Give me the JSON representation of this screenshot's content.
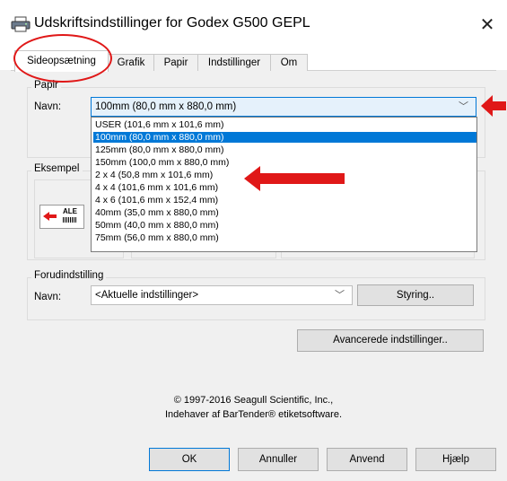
{
  "window": {
    "title": "Udskriftsindstillinger for Godex G500 GEPL",
    "close_label": "✕"
  },
  "tabs": [
    "Sideopsætning",
    "Grafik",
    "Papir",
    "Indstillinger",
    "Om"
  ],
  "active_tab": "Sideopsætning",
  "paper_group": {
    "label": "Papir",
    "name_label": "Navn:",
    "selected": "100mm (80,0 mm x 880,0 mm)",
    "options": [
      "USER (101,6 mm x 101,6 mm)",
      "100mm (80,0 mm x 880,0 mm)",
      "125mm (80,0 mm x 880,0 mm)",
      "150mm (100,0 mm x 880,0 mm)",
      "2 x 4 (50,8 mm x 101,6 mm)",
      "4 x 4 (101,6 mm x 101,6 mm)",
      "4 x 6 (101,6 mm x 152,4 mm)",
      "40mm (35,0 mm x 880,0 mm)",
      "50mm (40,0 mm x 880,0 mm)",
      "75mm (56,0 mm x 880,0 mm)"
    ],
    "highlighted_index": 1
  },
  "example_group": {
    "label": "Eksempel",
    "preview_text": "ALE"
  },
  "preset_group": {
    "label": "Forudindstilling",
    "name_label": "Navn:",
    "selected": "<Aktuelle indstillinger>",
    "manage_button": "Styring.."
  },
  "advanced_button": "Avancerede indstillinger..",
  "copyright": {
    "line1": "© 1997-2016 Seagull Scientific, Inc.,",
    "line2": "Indehaver af BarTender® etiketsoftware."
  },
  "footer_buttons": {
    "ok": "OK",
    "cancel": "Annuller",
    "apply": "Anvend",
    "help": "Hjælp"
  },
  "icons": {
    "title": "printer-icon",
    "dropdown": "chevron-down-icon"
  },
  "colors": {
    "selection": "#0078d7",
    "annotation": "#e01818"
  }
}
